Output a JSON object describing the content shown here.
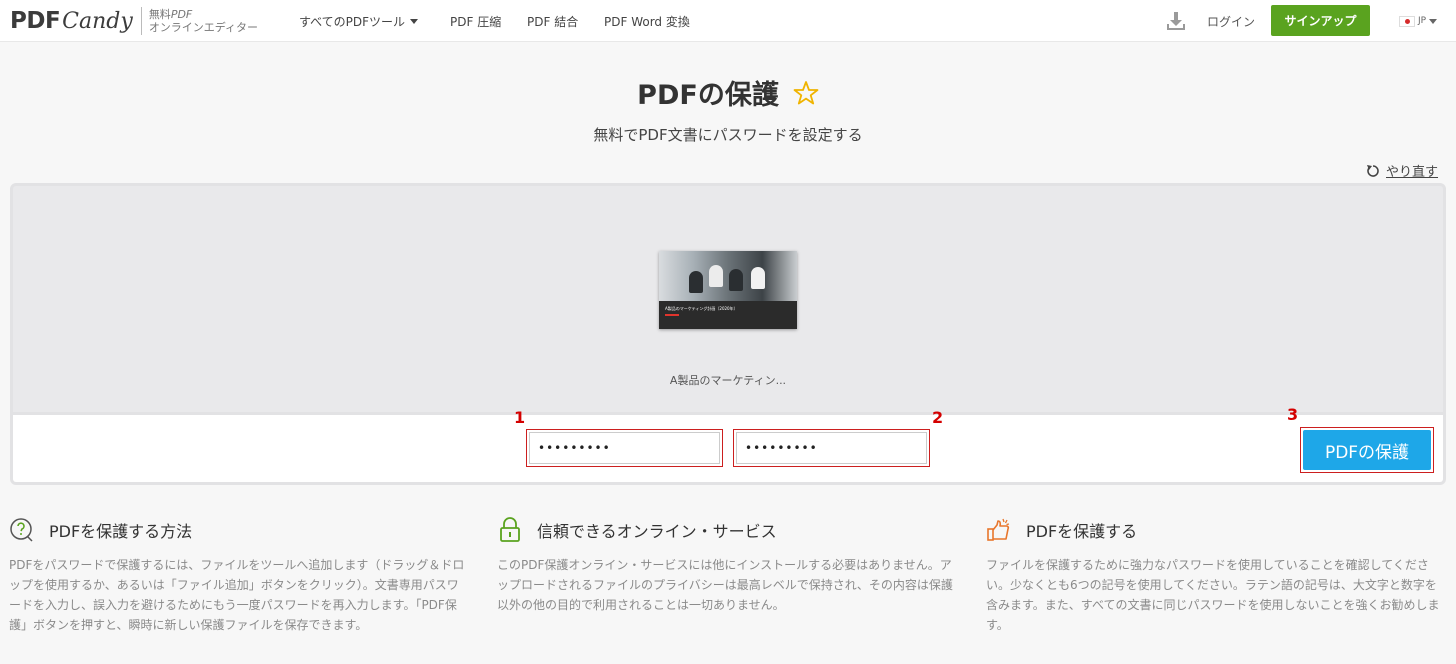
{
  "header": {
    "logo_pdf": "PDF",
    "logo_candy": "Candy",
    "logo_tag_line1_a": "無料",
    "logo_tag_line1_b": "PDF",
    "logo_tag_line2": "オンラインエディター",
    "nav": {
      "all_tools": "すべてのPDFツール",
      "compress": "PDF 圧縮",
      "merge": "PDF 結合",
      "word": "PDF Word 変換"
    },
    "login": "ログイン",
    "signup": "サインアップ",
    "lang": "JP"
  },
  "main": {
    "title": "PDFの保護",
    "subtitle": "無料でPDF文書にパスワードを設定する",
    "redo": "やり直す"
  },
  "workspace": {
    "thumbnail_caption": "A製品のマーケティング計画（2020年）",
    "file_name": "A製品のマーケティン...",
    "password1_value": "•••••••••",
    "password2_value": "•••••••••",
    "protect_button": "PDFの保護",
    "markers": [
      "1",
      "2",
      "3"
    ]
  },
  "info": [
    {
      "icon": "question-bubble-icon",
      "title": "PDFを保護する方法",
      "body": "PDFをパスワードで保護するには、ファイルをツールへ追加します（ドラッグ＆ドロップを使用するか、あるいは「ファイル追加」ボタンをクリック）。文書専用パスワードを入力し、誤入力を避けるためにもう一度パスワードを再入力します。「PDF保護」ボタンを押すと、瞬時に新しい保護ファイルを保存できます。"
    },
    {
      "icon": "lock-icon",
      "title": "信頼できるオンライン・サービス",
      "body": "このPDF保護オンライン・サービスには他にインストールする必要はありません。アップロードされるファイルのプライバシーは最高レベルで保持され、その内容は保護以外の他の目的で利用されることは一切ありません。"
    },
    {
      "icon": "thumbs-up-icon",
      "title": "PDFを保護する",
      "body": "ファイルを保護するために強力なパスワードを使用していることを確認してください。少なくとも6つの記号を使用してください。ラテン語の記号は、大文字と数字を含みます。また、すべての文書に同じパスワードを使用しないことを強くお勧めします。"
    }
  ],
  "colors": {
    "signup_green": "#5aa31f",
    "protect_blue": "#1ea7e8",
    "marker_red": "#d40000",
    "accent_green": "#5aa31f",
    "accent_orange": "#e8762c",
    "star_yellow": "#f0b400"
  }
}
